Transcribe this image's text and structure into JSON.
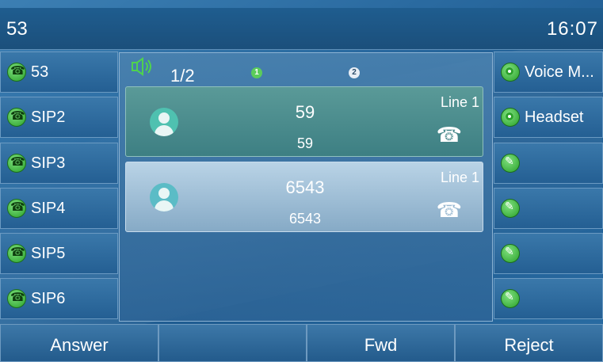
{
  "title_bar": {
    "account": "53",
    "time": "16:07"
  },
  "left_keys": [
    {
      "label": "53",
      "icon": "phone-icon"
    },
    {
      "label": "SIP2",
      "icon": "phone-icon"
    },
    {
      "label": "SIP3",
      "icon": "phone-icon"
    },
    {
      "label": "SIP4",
      "icon": "phone-icon"
    },
    {
      "label": "SIP5",
      "icon": "phone-icon"
    },
    {
      "label": "SIP6",
      "icon": "phone-icon"
    }
  ],
  "right_keys": [
    {
      "label": "Voice M...",
      "icon": "radio-icon"
    },
    {
      "label": "Headset",
      "icon": "radio-icon"
    },
    {
      "label": "",
      "icon": "pencil-icon"
    },
    {
      "label": "",
      "icon": "pencil-icon"
    },
    {
      "label": "",
      "icon": "pencil-icon"
    },
    {
      "label": "",
      "icon": "pencil-icon"
    }
  ],
  "calls": {
    "counter": "1/2",
    "indicators": [
      "1",
      "2"
    ],
    "items": [
      {
        "name": "59",
        "number": "59",
        "line": "Line 1"
      },
      {
        "name": "6543",
        "number": "6543",
        "line": "Line 1"
      }
    ]
  },
  "softkeys": [
    "Answer",
    "",
    "Fwd",
    "Reject"
  ],
  "colors": {
    "accent": "#2aa12a",
    "panel": "#2a6aa0"
  }
}
